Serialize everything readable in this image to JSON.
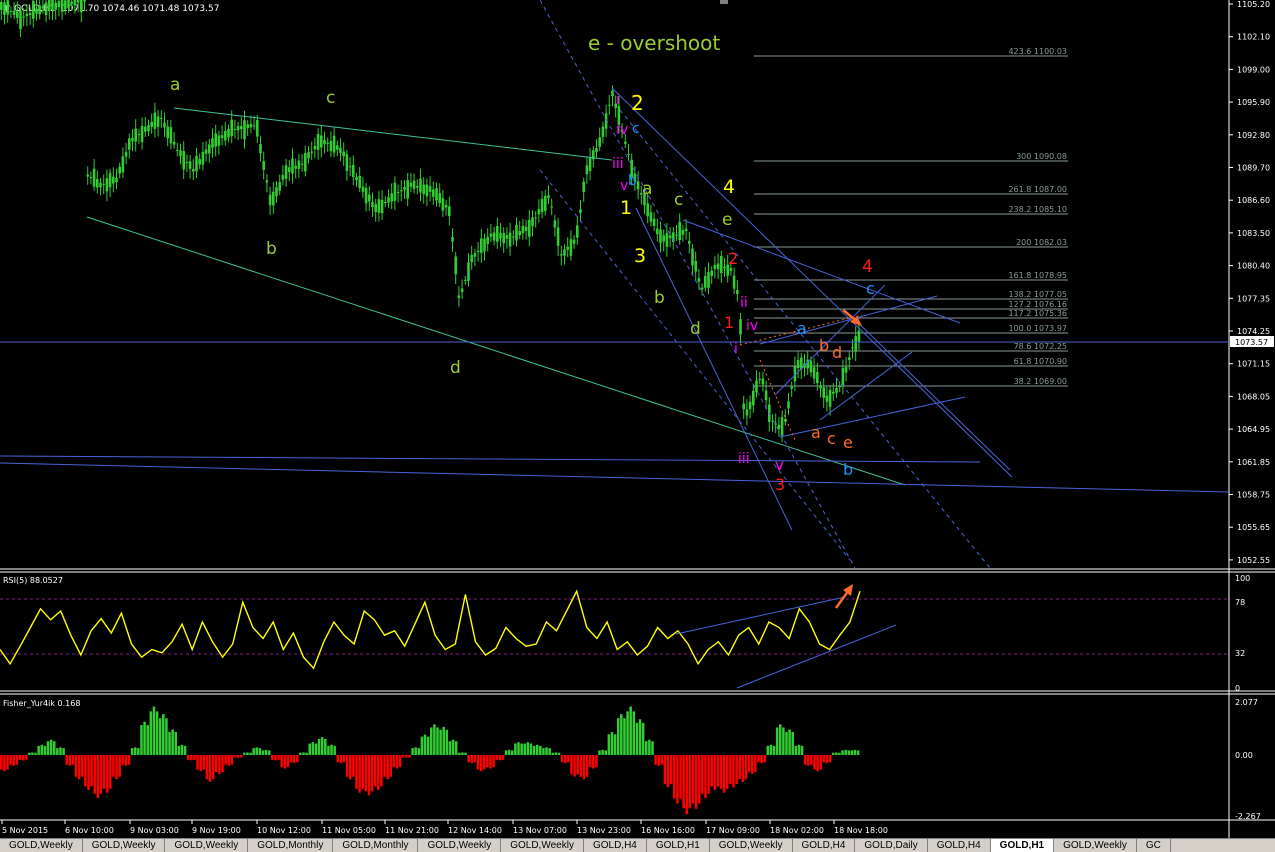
{
  "main": {
    "header": {
      "symbol": "GOLD,H1",
      "ohlc": "1071.70 1074.46 1071.48 1073.57"
    },
    "price_labels": [
      "1105.20",
      "1102.10",
      "1099.00",
      "1095.90",
      "1092.80",
      "1089.70",
      "1086.60",
      "1083.50",
      "1080.40",
      "1077.35",
      "1074.25",
      "1071.15",
      "1068.05",
      "1064.95",
      "1061.85",
      "1058.75",
      "1055.65",
      "1052.55"
    ],
    "current_price": "1073.57",
    "title_annotation": "e - overshoot",
    "fib_levels": [
      "423.6 1100.03",
      "300 1090.08",
      "261.8 1087.00",
      "238.2 1085.10",
      "200 1082.03",
      "161.8 1078.95",
      "138.2 1077.05",
      "127.2 1076.16",
      "117.2 1075.36",
      "100.0 1073.97",
      "78.6 1072.25",
      "61.8 1070.90",
      "38.2 1069.00"
    ]
  },
  "wave_labels": {
    "a1": "a",
    "b1": "b",
    "c1": "c",
    "d1": "d",
    "i_top": "i",
    "iv_top": "iv",
    "iii_top": "iii",
    "v_top": "v",
    "two": "2",
    "c_blue_top": "c",
    "b_blue_top": "b",
    "one": "1",
    "a_top": "a",
    "three": "3",
    "b_mid": "b",
    "c_mid": "c",
    "d_mid": "d",
    "four": "4",
    "e_mid": "e",
    "red2": "2",
    "ii": "ii",
    "red1": "1",
    "iv_low": "iv",
    "i_low": "i",
    "a_blue": "a",
    "b_or": "b",
    "d_or": "d",
    "a_or": "a",
    "c_or": "c",
    "e_or": "e",
    "iii_low": "iii",
    "v_low": "v",
    "red3": "3",
    "b_blue_low": "b",
    "red4": "4",
    "c_blue_right": "c"
  },
  "rsi": {
    "label": "RSI(5) 88.0527",
    "scale": [
      "100",
      "78",
      "32",
      "0"
    ],
    "chart_data": {
      "type": "line",
      "title": "RSI(5) 88.0527",
      "ylim": [
        0,
        100
      ],
      "levels": [
        78,
        32
      ],
      "series": [
        {
          "name": "RSI(5)",
          "values": [
            35,
            22,
            38,
            55,
            72,
            62,
            70,
            48,
            30,
            52,
            63,
            50,
            68,
            40,
            28,
            35,
            32,
            42,
            58,
            35,
            60,
            42,
            28,
            40,
            78,
            55,
            45,
            60,
            35,
            50,
            28,
            18,
            42,
            60,
            48,
            40,
            70,
            62,
            48,
            52,
            38,
            58,
            78,
            48,
            35,
            40,
            85,
            42,
            30,
            36,
            55,
            45,
            38,
            40,
            60,
            52,
            70,
            88,
            55,
            45,
            60,
            35,
            42,
            30,
            38,
            55,
            45,
            52,
            40,
            22,
            35,
            42,
            30,
            48,
            55,
            40,
            60,
            55,
            45,
            72,
            60,
            40,
            35,
            48,
            60,
            88
          ]
        }
      ]
    }
  },
  "fisher": {
    "label": "Fisher_Yur4ik 0.168",
    "scale": [
      "2.077",
      "0.00",
      "-2.267"
    ],
    "chart_data": {
      "type": "bar",
      "title": "Fisher_Yur4ik 0.168",
      "ylim": [
        -2.267,
        2.077
      ],
      "values": [
        -0.6,
        -0.4,
        -0.2,
        0.1,
        0.4,
        0.6,
        0.3,
        -0.4,
        -0.9,
        -1.3,
        -1.6,
        -1.4,
        -0.9,
        -0.4,
        0.3,
        1.3,
        1.9,
        1.6,
        1.0,
        0.4,
        -0.2,
        -0.6,
        -1.0,
        -0.7,
        -0.4,
        -0.1,
        0.1,
        0.3,
        0.2,
        -0.2,
        -0.5,
        -0.3,
        0.1,
        0.5,
        0.7,
        0.4,
        -0.3,
        -0.9,
        -1.4,
        -1.5,
        -1.3,
        -0.9,
        -0.5,
        -0.1,
        0.3,
        0.8,
        1.2,
        1.1,
        0.6,
        0.1,
        -0.3,
        -0.6,
        -0.5,
        -0.2,
        0.2,
        0.5,
        0.5,
        0.4,
        0.3,
        0.1,
        -0.3,
        -0.8,
        -0.9,
        -0.5,
        0.2,
        0.9,
        1.6,
        1.9,
        1.4,
        0.6,
        -0.4,
        -1.2,
        -1.8,
        -2.2,
        -2.0,
        -1.6,
        -1.3,
        -1.4,
        -1.2,
        -1.0,
        -0.7,
        -0.3,
        0.4,
        1.2,
        1.0,
        0.4,
        -0.4,
        -0.6,
        -0.3,
        0.1,
        0.2,
        0.2
      ]
    }
  },
  "time_labels": [
    "5 Nov 2015",
    "6 Nov 10:00",
    "9 Nov 03:00",
    "9 Nov 19:00",
    "10 Nov 12:00",
    "11 Nov 05:00",
    "11 Nov 21:00",
    "12 Nov 14:00",
    "13 Nov 07:00",
    "13 Nov 23:00",
    "16 Nov 16:00",
    "17 Nov 09:00",
    "18 Nov 02:00",
    "18 Nov 18:00"
  ],
  "tabs": [
    "GOLD,Weekly",
    "GOLD,Weekly",
    "GOLD,Weekly",
    "GOLD,Monthly",
    "GOLD,Monthly",
    "GOLD,Weekly",
    "GOLD,Weekly",
    "GOLD,H4",
    "GOLD,H1",
    "GOLD,Weekly",
    "GOLD,H4",
    "GOLD,Daily",
    "GOLD,H4",
    "GOLD,H1",
    "GOLD,Weekly",
    "GC"
  ],
  "active_tab": 13,
  "colors": {
    "bull": "#32cd32",
    "bear": "#ff0000",
    "rsi": "#ffff00",
    "trend": "#4a64d8",
    "channel": "#40c0a0",
    "wave_green": "#9acd32",
    "wave_yellow": "#ffff00",
    "wave_magenta": "#ff00ff",
    "wave_blue": "#1e90ff",
    "wave_red": "#ff1a1a",
    "wave_orange": "#ff6a2a"
  }
}
